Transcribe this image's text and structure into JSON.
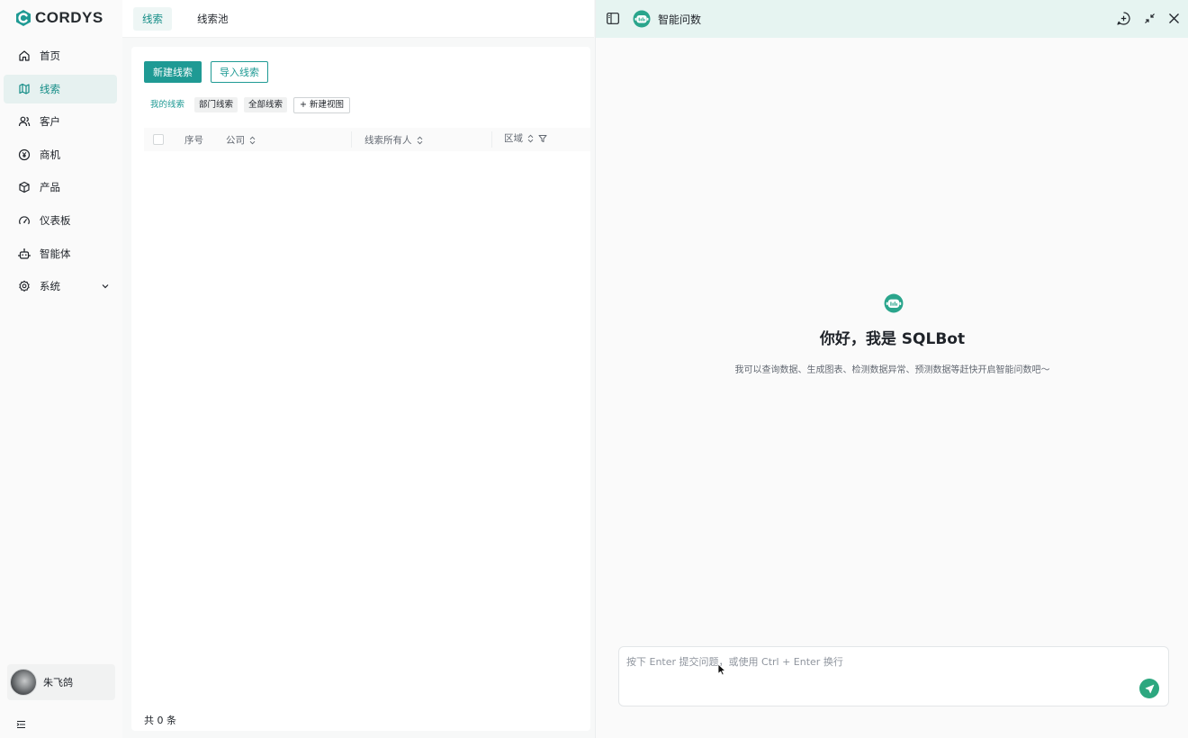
{
  "brand": {
    "name": "CORDYS",
    "accent": "#1f9a94"
  },
  "nav": {
    "items": [
      {
        "label": "首页",
        "icon": "home-icon",
        "active": false
      },
      {
        "label": "线索",
        "icon": "leads-icon",
        "active": true
      },
      {
        "label": "客户",
        "icon": "customers-icon",
        "active": false
      },
      {
        "label": "商机",
        "icon": "opportunity-icon",
        "active": false
      },
      {
        "label": "产品",
        "icon": "product-box-icon",
        "active": false
      },
      {
        "label": "仪表板",
        "icon": "dashboard-gauge-icon",
        "active": false
      },
      {
        "label": "智能体",
        "icon": "agent-robot-icon",
        "active": false
      },
      {
        "label": "系统",
        "icon": "system-gear-icon",
        "active": false,
        "expandable": true
      }
    ]
  },
  "user": {
    "name": "朱飞鸽"
  },
  "tabs": [
    {
      "label": "线索",
      "active": true
    },
    {
      "label": "线索池",
      "active": false
    }
  ],
  "toolbar": {
    "new_label": "新建线索",
    "import_label": "导入线索"
  },
  "views": {
    "items": [
      "我的线索",
      "部门线索",
      "全部线索"
    ],
    "add_label": "+ 新建视图"
  },
  "table": {
    "columns": [
      "序号",
      "公司",
      "线索所有人",
      "区域"
    ],
    "rows": [],
    "total": "共 0 条"
  },
  "ai": {
    "title": "智能问数",
    "welcome_title": "你好，我是 SQLBot",
    "welcome_sub": "我可以查询数据、生成图表、检测数据异常、预测数据等赶快开启智能问数吧～",
    "input_placeholder": "按下 Enter 提交问题，或使用 Ctrl + Enter 换行",
    "send_color": "#2ca77f",
    "header_bg": "#e6f4f1"
  }
}
